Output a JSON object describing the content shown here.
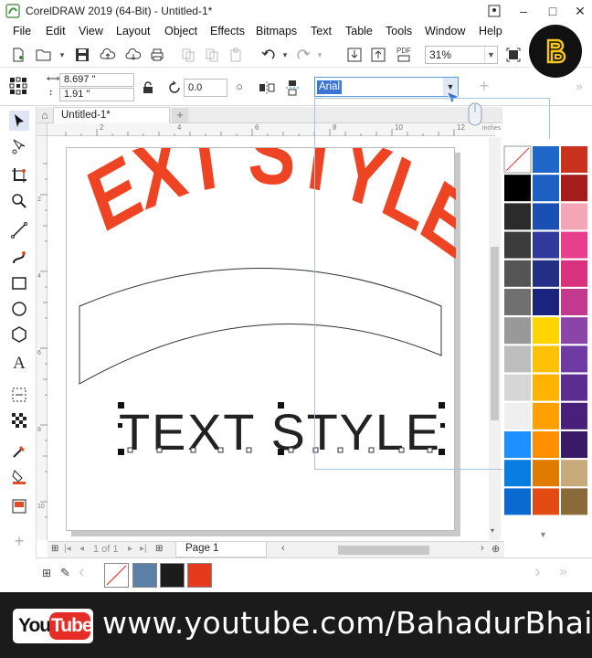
{
  "window": {
    "title": "CorelDRAW 2019 (64-Bit) - Untitled-1*",
    "minimize_glyph": "–",
    "maximize_glyph": "□",
    "close_glyph": "✕"
  },
  "menu": {
    "items": [
      {
        "label": "File"
      },
      {
        "label": "Edit"
      },
      {
        "label": "View"
      },
      {
        "label": "Layout"
      },
      {
        "label": "Object"
      },
      {
        "label": "Effects"
      },
      {
        "label": "Bitmaps"
      },
      {
        "label": "Text"
      },
      {
        "label": "Table"
      },
      {
        "label": "Tools"
      },
      {
        "label": "Window"
      },
      {
        "label": "Help"
      }
    ]
  },
  "toolbar": {
    "zoom_value": "31%",
    "pdf_label": "PDF"
  },
  "property_bar": {
    "width_value": "8.697 \"",
    "height_value": "1.91 \"",
    "rotation_value": "0.0",
    "font_name": "Arial"
  },
  "document": {
    "tab_label": "Untitled-1*",
    "ruler_ticks": [
      "2",
      "4",
      "6",
      "8",
      "10",
      "12"
    ],
    "ruler_unit": "inches",
    "vruler_ticks": [
      "2",
      "4",
      "6",
      "8",
      "10"
    ],
    "arched_text": "TEXT STYLE",
    "plain_text": "TEXT STYLE"
  },
  "page_nav": {
    "page_count_text": "1 of 1",
    "page_tab_label": "Page 1"
  },
  "palette": {
    "colors": [
      [
        "none",
        "#1f68c9",
        "#c8321e"
      ],
      [
        "#000000",
        "#1e5fc4",
        "#a41d1b"
      ],
      [
        "#2b2b2b",
        "#1a4fb3",
        "#f4a6b8"
      ],
      [
        "#3c3c3c",
        "#2f3a9a",
        "#e83e8c"
      ],
      [
        "#555555",
        "#243085",
        "#d8327e"
      ],
      [
        "#707070",
        "#1a237e",
        "#c2398d"
      ],
      [
        "#999999",
        "#ffd400",
        "#8b44a8"
      ],
      [
        "#bdbdbd",
        "#ffc107",
        "#6f3aa3"
      ],
      [
        "#d6d6d6",
        "#ffb300",
        "#5c2d91"
      ],
      [
        "#efefef",
        "#ffa000",
        "#4a1f7a"
      ],
      [
        "#1e90ff",
        "#ff8f00",
        "#3a1a66"
      ],
      [
        "#0a7de0",
        "#e07b00",
        "#c8a97a"
      ],
      [
        "#0a6ad0",
        "#e44b12",
        "#8a6a3a"
      ]
    ],
    "doc_colors": [
      "none",
      "#5b7fa6",
      "#1c1c1c",
      "#e53a1e"
    ]
  },
  "footer": {
    "yt_you": "You",
    "yt_tube": "Tube",
    "url": "www.youtube.com/BahadurBhai"
  },
  "accent": {
    "arched_text_color": "#ef4423",
    "selection_blue": "#3b76d6"
  }
}
